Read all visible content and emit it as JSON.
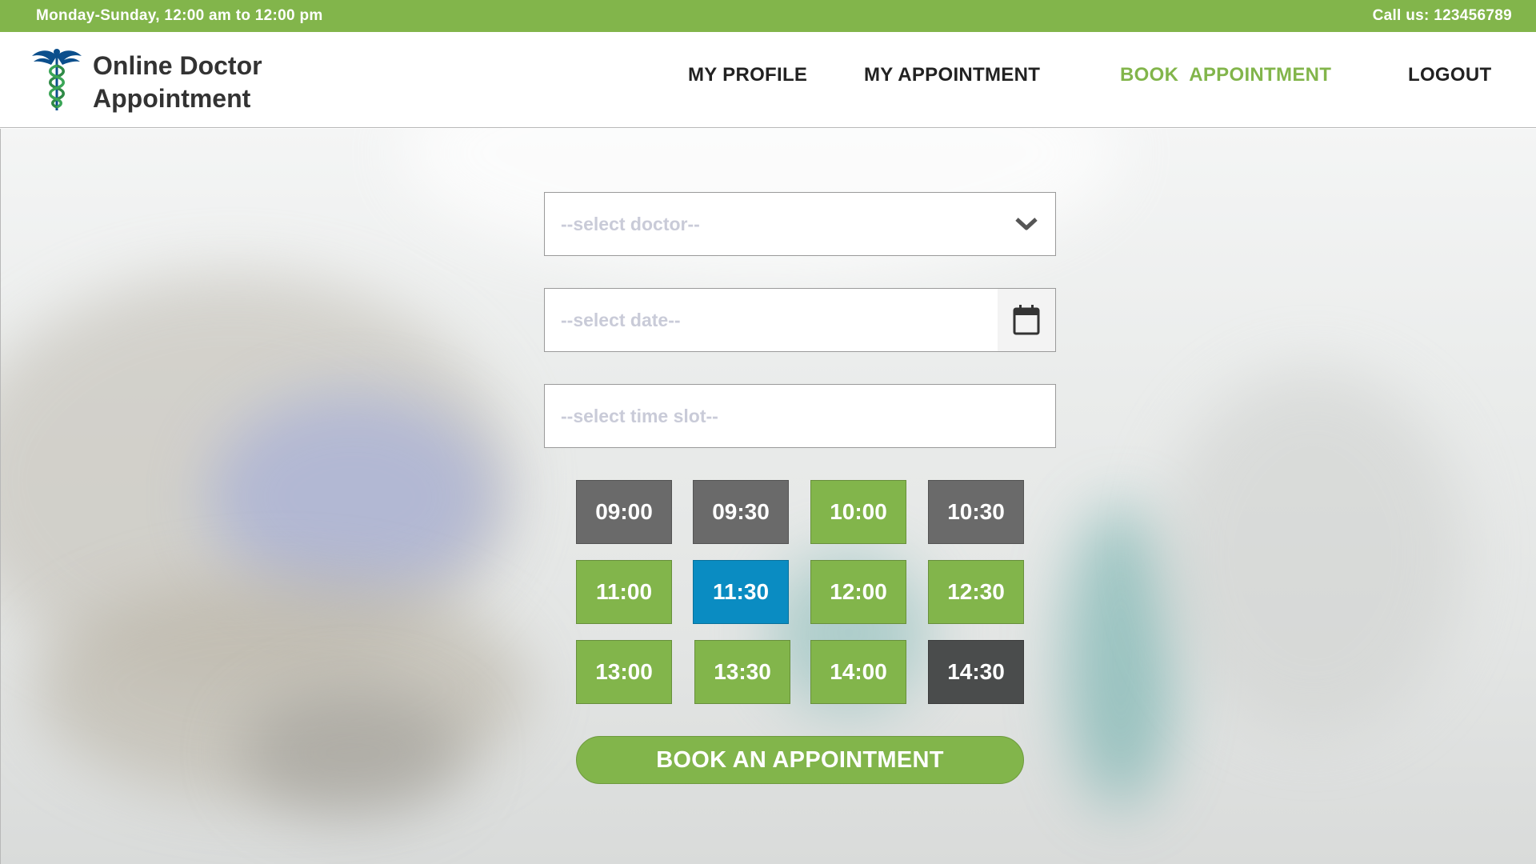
{
  "topbar": {
    "hours": "Monday-Sunday, 12:00 am to 12:00 pm",
    "phone": "Call us: 123456789"
  },
  "brand": {
    "line1": "Online Doctor",
    "line2": "Appointment",
    "icon": "caduceus-icon"
  },
  "nav": {
    "profile": "MY PROFILE",
    "appointments": "MY APPOINTMENT",
    "book": "BOOK  APPOINTMENT",
    "logout": "LOGOUT",
    "active": "book"
  },
  "form": {
    "doctor_placeholder": "--select doctor--",
    "date_placeholder": "--select date--",
    "time_placeholder": "--select time slot--",
    "doctor_icon": "chevron-down-icon",
    "date_icon": "calendar-icon"
  },
  "slots": [
    {
      "time": "09:00",
      "status": "booked"
    },
    {
      "time": "09:30",
      "status": "booked"
    },
    {
      "time": "10:00",
      "status": "available"
    },
    {
      "time": "10:30",
      "status": "booked"
    },
    {
      "time": "11:00",
      "status": "available"
    },
    {
      "time": "11:30",
      "status": "selected"
    },
    {
      "time": "12:00",
      "status": "available"
    },
    {
      "time": "12:30",
      "status": "available"
    },
    {
      "time": "13:00",
      "status": "available"
    },
    {
      "time": "13:30",
      "status": "available"
    },
    {
      "time": "14:00",
      "status": "available"
    },
    {
      "time": "14:30",
      "status": "booked"
    }
  ],
  "book_button": "BOOK AN APPOINTMENT",
  "colors": {
    "brand_green": "#82b54b",
    "selected_blue": "#0a8cc2",
    "booked_gray": "#6a6a6a"
  }
}
